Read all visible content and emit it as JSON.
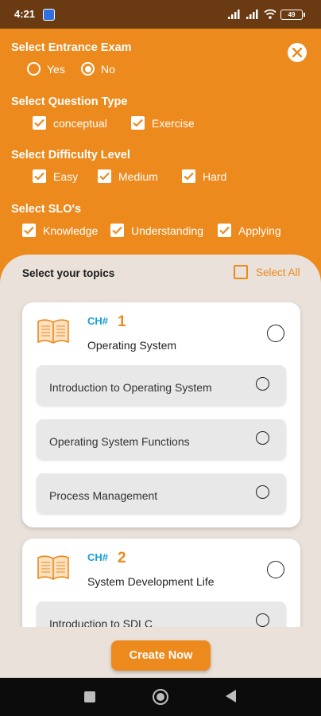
{
  "status_bar": {
    "time": "4:21",
    "battery": "49"
  },
  "filters": {
    "entrance_exam": {
      "title": "Select Entrance Exam",
      "options": [
        {
          "label": "Yes",
          "selected": false
        },
        {
          "label": "No",
          "selected": true
        }
      ]
    },
    "question_type": {
      "title": "Select Question Type",
      "options": [
        {
          "label": "conceptual",
          "checked": true
        },
        {
          "label": "Exercise",
          "checked": true
        }
      ]
    },
    "difficulty": {
      "title": "Select Difficulty Level",
      "options": [
        {
          "label": "Easy",
          "checked": true
        },
        {
          "label": "Medium",
          "checked": true
        },
        {
          "label": "Hard",
          "checked": true
        }
      ]
    },
    "slo": {
      "title": "Select SLO's",
      "options": [
        {
          "label": "Knowledge",
          "checked": true
        },
        {
          "label": "Understanding",
          "checked": true
        },
        {
          "label": "Applying",
          "checked": true
        }
      ]
    }
  },
  "topics": {
    "title": "Select your topics",
    "select_all": "Select All",
    "chapters": [
      {
        "prefix": "CH#",
        "number": "1",
        "name": "Operating System",
        "topics": [
          "Introduction to Operating System",
          "Operating System Functions",
          "Process Management"
        ]
      },
      {
        "prefix": "CH#",
        "number": "2",
        "name": "System Development Life",
        "topics": [
          "Introduction to SDLC"
        ]
      }
    ]
  },
  "create_button": "Create Now",
  "colors": {
    "accent": "#ec8a1d",
    "status_bar": "#6a3b12",
    "ch_label": "#1a9fd6",
    "background": "#e9e1da"
  }
}
